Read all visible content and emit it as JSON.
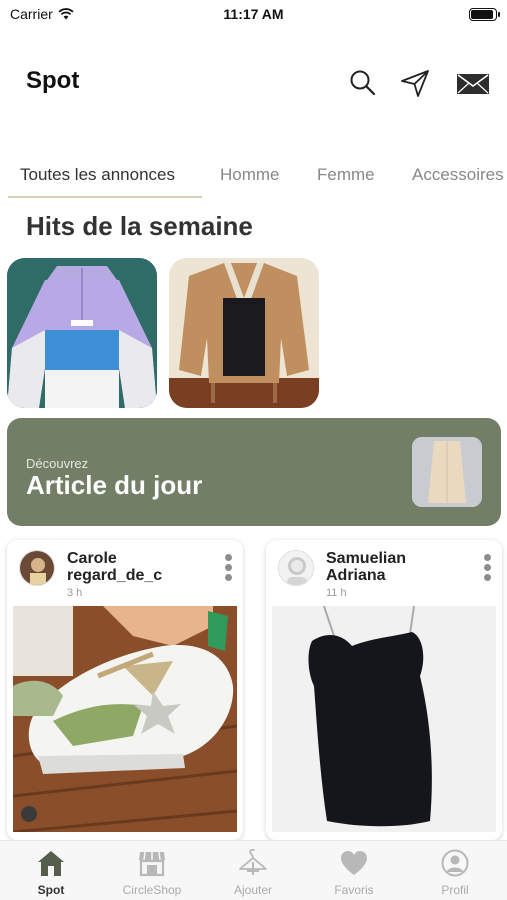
{
  "status_bar": {
    "carrier": "Carrier",
    "time": "11:17 AM",
    "battery_level": 0.9
  },
  "header": {
    "title": "Spot",
    "icons": [
      "search-icon",
      "send-icon",
      "mail-icon"
    ]
  },
  "tabs": [
    {
      "label": "Toutes les annonces",
      "active": true
    },
    {
      "label": "Homme",
      "active": false
    },
    {
      "label": "Femme",
      "active": false
    },
    {
      "label": "Accessoires",
      "active": false
    }
  ],
  "hits": {
    "title": "Hits de la semaine"
  },
  "banner": {
    "subtitle": "Découvrez",
    "title": "Article du jour"
  },
  "feed": [
    {
      "user": "Carole regard_de_c",
      "time": "3 h"
    },
    {
      "user": "Samuelian Adriana",
      "time": "11 h"
    }
  ],
  "bottom_nav": [
    {
      "label": "Spot",
      "icon": "home-icon",
      "active": true
    },
    {
      "label": "CircleShop",
      "icon": "shop-icon",
      "active": false
    },
    {
      "label": "Ajouter",
      "icon": "hanger-add-icon",
      "active": false
    },
    {
      "label": "Favoris",
      "icon": "heart-icon",
      "active": false
    },
    {
      "label": "Profil",
      "icon": "profile-icon",
      "active": false
    }
  ],
  "colors": {
    "accent": "#737e67",
    "nav_active": "#555e4a",
    "tab_underline": "#d8cfb6"
  }
}
